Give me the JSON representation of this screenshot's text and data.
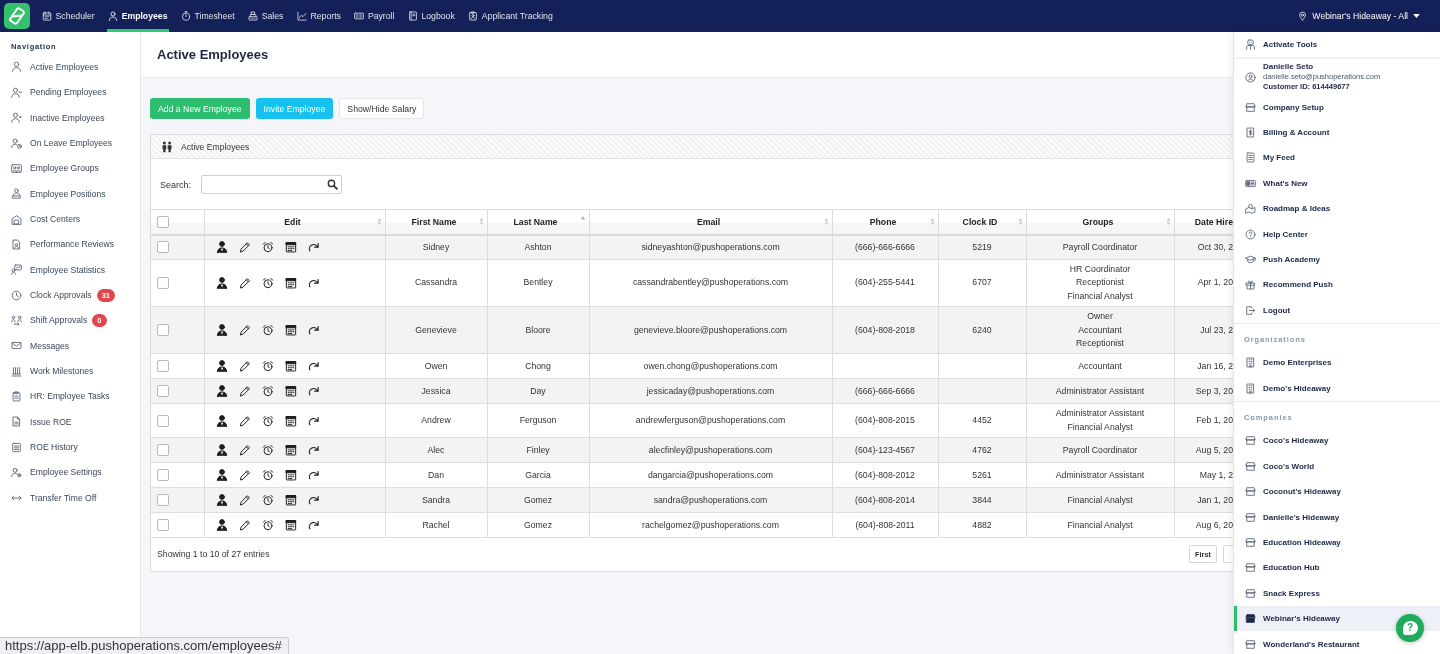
{
  "top_bar": {
    "nav_tabs": [
      {
        "label": "Scheduler",
        "selected": false
      },
      {
        "label": "Employees",
        "selected": true
      },
      {
        "label": "Timesheet",
        "selected": false
      },
      {
        "label": "Sales",
        "selected": false
      },
      {
        "label": "Reports",
        "selected": false
      },
      {
        "label": "Payroll",
        "selected": false
      },
      {
        "label": "Logbook",
        "selected": false
      },
      {
        "label": "Applicant Tracking",
        "selected": false
      }
    ],
    "location_selector": "Webinar's Hideaway - All"
  },
  "sidebar": {
    "heading": "Navigation",
    "items": [
      {
        "label": "Active Employees"
      },
      {
        "label": "Pending Employees"
      },
      {
        "label": "Inactive Employees"
      },
      {
        "label": "On Leave Employees"
      },
      {
        "label": "Employee Groups"
      },
      {
        "label": "Employee Positions"
      },
      {
        "label": "Cost Centers"
      },
      {
        "label": "Performance Reviews"
      },
      {
        "label": "Employee Statistics"
      },
      {
        "label": "Clock Approvals",
        "badge": "31"
      },
      {
        "label": "Shift Approvals",
        "badge": "0"
      },
      {
        "label": "Messages"
      },
      {
        "label": "Work Milestones"
      },
      {
        "label": "HR: Employee Tasks"
      },
      {
        "label": "Issue ROE"
      },
      {
        "label": "ROE History"
      },
      {
        "label": "Employee Settings"
      },
      {
        "label": "Transfer Time Off"
      }
    ]
  },
  "page": {
    "title": "Active Employees",
    "buttons": [
      {
        "label": "Add a New Employee",
        "kind": "success"
      },
      {
        "label": "Invite Employee",
        "kind": "info"
      },
      {
        "label": "Show/Hide Salary",
        "kind": "default"
      }
    ]
  },
  "panel": {
    "title": "Active Employees",
    "search_label": "Search:",
    "table": {
      "select_all_checked": false,
      "columns": [
        {
          "label": "Edit",
          "sorted": false
        },
        {
          "label": "First Name",
          "sorted": false
        },
        {
          "label": "Last Name",
          "sorted": true
        },
        {
          "label": "Email",
          "sorted": false
        },
        {
          "label": "Phone",
          "sorted": false
        },
        {
          "label": "Clock ID",
          "sorted": false
        },
        {
          "label": "Groups",
          "sorted": false
        },
        {
          "label": "Date Hire"
        }
      ],
      "rows": [
        {
          "checked": false,
          "first_name": "Sidney",
          "last_name": "Ashton",
          "email": "sidneyashton@pushoperations.com",
          "phone": "(666)-666-6666",
          "clock_id": "5219",
          "groups": [
            "Payroll Coordinator"
          ],
          "date_hire": "Oct 30, 2"
        },
        {
          "checked": false,
          "first_name": "Cassandra",
          "last_name": "Bentley",
          "email": "cassandrabentley@pushoperations.com",
          "phone": "(604)-255-5441",
          "clock_id": "6707",
          "groups": [
            "HR Coordinator",
            "Receptionist",
            "Financial Analyst"
          ],
          "date_hire": "Apr 1, 20"
        },
        {
          "checked": false,
          "first_name": "Genevieve",
          "last_name": "Bloore",
          "email": "genevieve.bloore@pushoperations.com",
          "phone": "(604)-808-2018",
          "clock_id": "6240",
          "groups": [
            "Owner",
            "Accountant",
            "Receptionist"
          ],
          "date_hire": "Jul 23, 2"
        },
        {
          "checked": false,
          "first_name": "Owen",
          "last_name": "Chong",
          "email": "owen.chong@pushoperations.com",
          "groups": [
            "Accountant"
          ],
          "date_hire": "Jan 16, 2"
        },
        {
          "checked": false,
          "first_name": "Jessica",
          "last_name": "Day",
          "email": "jessicaday@pushoperations.com",
          "phone": "(666)-666-6666",
          "groups": [
            "Administrator Assistant"
          ],
          "date_hire": "Sep 3, 20"
        },
        {
          "checked": false,
          "first_name": "Andrew",
          "last_name": "Ferguson",
          "email": "andrewferguson@pushoperations.com",
          "phone": "(604)-808-2015",
          "clock_id": "4452",
          "groups": [
            "Administrator Assistant",
            "Financial Analyst"
          ],
          "date_hire": "Feb 1, 20"
        },
        {
          "checked": false,
          "first_name": "Alec",
          "last_name": "Finley",
          "email": "alecfinley@pushoperations.com",
          "phone": "(604)-123-4567",
          "clock_id": "4762",
          "groups": [
            "Payroll Coordinator"
          ],
          "date_hire": "Aug 5, 20"
        },
        {
          "checked": false,
          "first_name": "Dan",
          "last_name": "Garcia",
          "email": "dangarcia@pushoperations.com",
          "phone": "(604)-808-2012",
          "clock_id": "5261",
          "groups": [
            "Administrator Assistant"
          ],
          "date_hire": "May 1, 2"
        },
        {
          "checked": false,
          "first_name": "Sandra",
          "last_name": "Gomez",
          "email": "sandra@pushoperations.com",
          "phone": "(604)-808-2014",
          "clock_id": "3844",
          "groups": [
            "Financial Analyst"
          ],
          "date_hire": "Jan 1, 20"
        },
        {
          "checked": false,
          "first_name": "Rachel",
          "last_name": "Gomez",
          "email": "rachelgomez@pushoperations.com",
          "phone": "(604)-808-2011",
          "clock_id": "4882",
          "groups": [
            "Financial Analyst"
          ],
          "date_hire": "Aug 6, 20"
        }
      ]
    },
    "info": "Showing 1 to 10 of 27 entries",
    "pagination": [
      "First"
    ]
  },
  "account_menu": {
    "top_item": "Activate Tools",
    "user": {
      "name": "Danielle Seto",
      "email": "danielle.seto@pushoperations.com",
      "customer_id": "Customer ID: 614449677"
    },
    "links": [
      "Company Setup",
      "Billing & Account",
      "My Feed",
      "What's New",
      "Roadmap & Ideas",
      "Help Center",
      "Push Academy",
      "Recommend Push",
      "Logout"
    ],
    "organizations": {
      "heading": "Organizations",
      "items": [
        {
          "label": "Demo Enterprises",
          "selected": false
        },
        {
          "label": "Demo's Hideaway",
          "selected": false
        }
      ]
    },
    "companies": {
      "heading": "Companies",
      "items": [
        {
          "label": "Coco's Hideaway",
          "selected": false
        },
        {
          "label": "Coco's World",
          "selected": false
        },
        {
          "label": "Coconut's Hideaway",
          "selected": false
        },
        {
          "label": "Danielle's Hideaway",
          "selected": false
        },
        {
          "label": "Education Hideaway",
          "selected": false
        },
        {
          "label": "Education Hub",
          "selected": false
        },
        {
          "label": "Snack Express",
          "selected": false
        },
        {
          "label": "Webinar's Hideaway",
          "selected": true
        },
        {
          "label": "Wonderland's Restaurant",
          "selected": false
        }
      ]
    }
  },
  "help_button": "?",
  "status_url": "https://app-elb.pushoperations.com/employees#"
}
